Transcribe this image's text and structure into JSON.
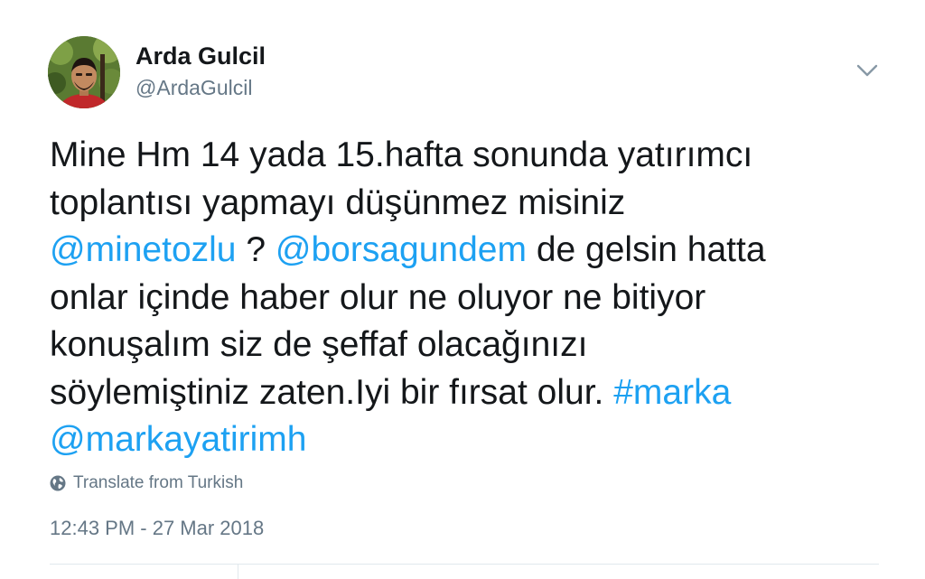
{
  "author": {
    "display_name": "Arda Gulcil",
    "handle": "@ArdaGulcil",
    "avatar_icon": "profile-photo"
  },
  "menu": {
    "icon": "chevron-down-icon"
  },
  "tweet": {
    "lines": [
      [
        {
          "text": "Mine Hm 14 yada 15.hafta sonunda yatırımcı",
          "type": "text"
        }
      ],
      [
        {
          "text": "toplantısı yapmayı düşünmez misiniz",
          "type": "text"
        }
      ],
      [
        {
          "text": "@minetozlu",
          "type": "mention"
        },
        {
          "text": " ? ",
          "type": "text"
        },
        {
          "text": "@borsagundem",
          "type": "mention"
        },
        {
          "text": " de gelsin hatta",
          "type": "text"
        }
      ],
      [
        {
          "text": "onlar içinde haber olur ne oluyor ne bitiyor",
          "type": "text"
        }
      ],
      [
        {
          "text": "konuşalım siz de şeffaf olacağınızı",
          "type": "text"
        }
      ],
      [
        {
          "text": "söylemiştiniz zaten.Iyi bir fırsat olur. ",
          "type": "text"
        },
        {
          "text": "#marka",
          "type": "hashtag"
        }
      ],
      [
        {
          "text": "@markayatirimh",
          "type": "mention"
        }
      ]
    ]
  },
  "translate": {
    "label": "Translate from Turkish",
    "icon": "globe-icon"
  },
  "timestamp": "12:43 PM - 27 Mar 2018",
  "colors": {
    "link": "#1da1f2",
    "secondary_text": "#657786",
    "primary_text": "#14171a",
    "divider": "#e1e8ed"
  }
}
